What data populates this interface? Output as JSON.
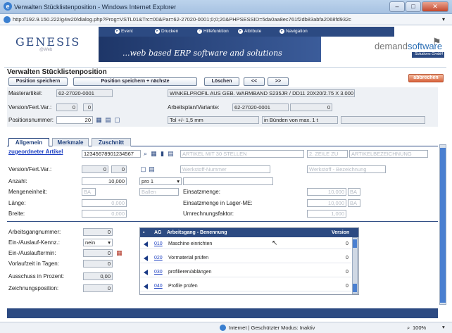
{
  "window": {
    "title": "Verwalten Stücklistenposition - Windows Internet Explorer",
    "url": "http://192.9.150.222/g4w20/dialog.php?Prog=VSTL01&Trc=00&Par=62-27020-0001;0;0;20&PHPSESSID=5da0aa8ec761f2db83abfa2068fd932c"
  },
  "nav": {
    "items": [
      "Event",
      "Drucken",
      "Hilfefunktion",
      "Attribute",
      "Navigation"
    ]
  },
  "brand": {
    "logo": "GENESIS",
    "logo_sub": "@Web",
    "slogan": "...web based ERP software and solutions",
    "vendor_a": "demand",
    "vendor_b": "software",
    "vendor_sub": "Solutions GmbH"
  },
  "page": {
    "title": "Verwalten Stücklistenposition"
  },
  "toolbar": {
    "save": "Position speichern",
    "save_next": "Position speichern + nächste",
    "delete": "Löschen",
    "prev": "<<",
    "next": ">>",
    "abort": "abbrechen"
  },
  "header_form": {
    "masterartikel_label": "Masterartikel:",
    "masterartikel": "62-27020-0001",
    "master_desc": "WINKELPROFIL AUS GEB. WARMBAND S235JR / DD11 20X20/2.75 X 3.000",
    "version_label": "Version/Fert.Var.:",
    "version": "0",
    "fertvar": "0",
    "arbeitsplan_label": "Arbeitsplan/Variante:",
    "arbeitsplan": "62-27020-0001",
    "variante": "0",
    "posnr_label": "Positionsnummer:",
    "posnr": "20",
    "tol": "Tol +/- 1,5 mm",
    "bundle": "in Bünden von max. 1 t"
  },
  "tabs": [
    "Allgemein",
    "Merkmale",
    "Zuschnitt"
  ],
  "general": {
    "zug_artikel_label": "zugeordneter Artikel",
    "zug_artikel": "12345678901234567",
    "artikel_desc_ph": "ARTIKEL MIT 30 STELLEN",
    "zeile2_ph": "2. ZEILE ZU",
    "artikel_bez_ph": "ARTIKELBEZEICHNUNG",
    "version_label": "Version/Fert.Var.:",
    "version": "0",
    "fertvar": "0",
    "werkstoff_nr_ph": "Werkstoff-Nummer",
    "werkstoff_bez_ph": "Werkstoff - Bezeichnung",
    "anzahl_label": "Anzahl:",
    "anzahl": "10,000",
    "pro": "pro 1",
    "me_label": "Mengeneinheit:",
    "me": "BA",
    "ballen": "Ballen",
    "einsatzmenge_label": "Einsatzmenge:",
    "einsatzmenge": "10,000",
    "einsatzmenge_unit": "BA",
    "laenge_label": "Länge:",
    "laenge": "0,000",
    "einsatz_lager_label": "Einsatzmenge in Lager-ME:",
    "einsatz_lager": "10,000",
    "einsatz_lager_unit": "BA",
    "breite_label": "Breite:",
    "breite": "0,000",
    "umrechnung_label": "Umrechnungsfaktor:",
    "umrechnung": "1,000"
  },
  "operations": {
    "agnr_label": "Arbeitsgangnummer:",
    "agnr": "0",
    "einaus_label": "Ein-/Auslauf-Kennz.:",
    "einaus": "nein",
    "termin_label": "Ein-/Auslauftermin:",
    "termin": "0",
    "vorlauf_label": "Vorlaufzeit in Tagen:",
    "vorlauf": "0",
    "ausschuss_label": "Ausschuss in Prozent:",
    "ausschuss": "0,00",
    "zeichnung_label": "Zeichnungsposition:",
    "zeichnung": "0",
    "grid_header": {
      "ag": "AG",
      "name": "Arbeitsgang - Benennung",
      "version": "Version"
    },
    "rows": [
      {
        "ag": "010",
        "name": "Maschine einrichten",
        "version": "0"
      },
      {
        "ag": "020",
        "name": "Vormaterial prüfen",
        "version": "0"
      },
      {
        "ag": "030",
        "name": "profilieren/ablängen",
        "version": "0"
      },
      {
        "ag": "040",
        "name": "Profile prüfen",
        "version": "0"
      }
    ]
  },
  "statusbar": {
    "zone": "Internet | Geschützter Modus: Inaktiv",
    "zoom": "100%"
  }
}
